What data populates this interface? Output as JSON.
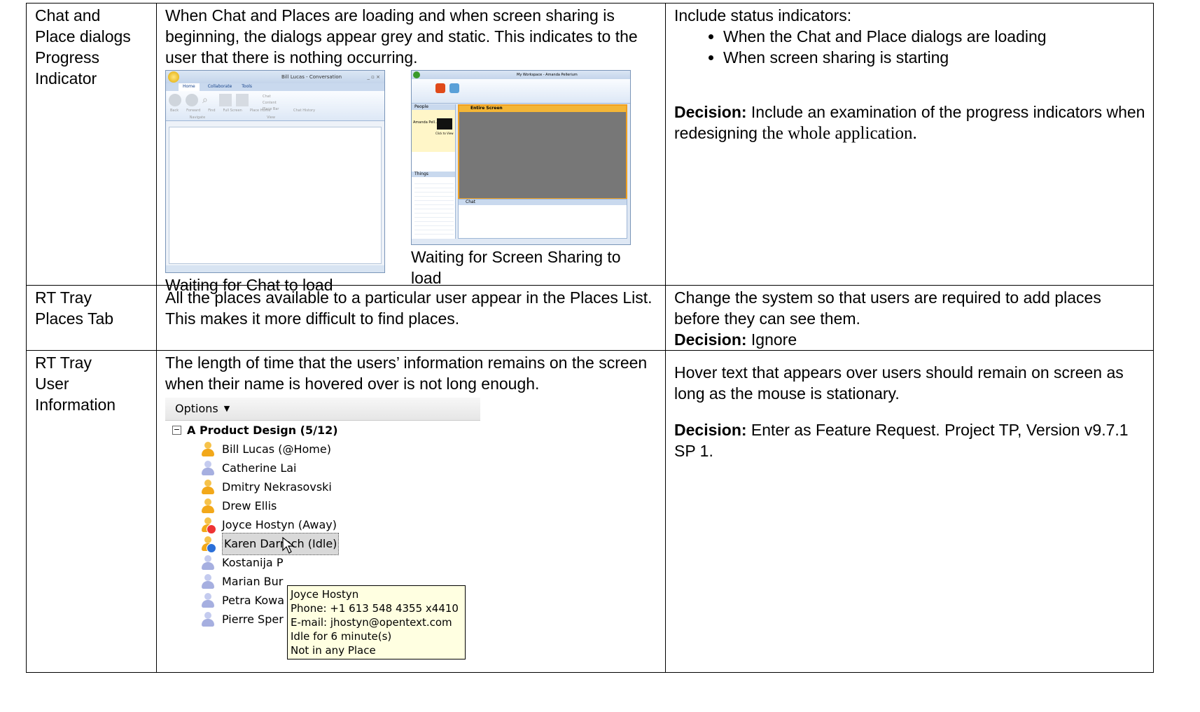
{
  "rows": [
    {
      "area": "Chat and Place dialogs Progress Indicator",
      "issue": "When Chat and Places are loading and when screen sharing is beginning, the dialogs appear grey and static. This indicates to the user that there is nothing occurring.",
      "rec_intro": "Include status indicators:",
      "rec_bullets": [
        "When the Chat and Place dialogs are loading",
        "When screen sharing is starting"
      ],
      "decision_label": "Decision:",
      "decision_a": "Include an examination of the progress indicators when redesigning",
      "decision_b": "the whole application.",
      "caption_left": "Waiting for Chat to load",
      "caption_right": "Waiting for Screen Sharing to load"
    },
    {
      "area_line1": "RT Tray",
      "area_line2": "Places Tab",
      "issue": "All the places available to a particular user appear in the Places List. This makes it more difficult to find places.",
      "rec": "Change the system so that users are required to add places before they can see them.",
      "decision_label": "Decision:",
      "decision": "Ignore"
    },
    {
      "area_line1": "RT Tray",
      "area_line2": "User Information",
      "issue": "The length of time that the users’ information remains on the screen when their name is hovered over is not long enough.",
      "rec": "Hover text that appears over users should remain on screen as long as the mouse is stationary.",
      "decision_label": "Decision:",
      "decision": "Enter as Feature Request. Project TP, Version v9.7.1 SP 1."
    }
  ],
  "chat_window": {
    "title": "Bill Lucas - Conversation",
    "tabs": [
      "Home",
      "Collaborate",
      "Tools"
    ],
    "buttons": [
      "Back",
      "Forward",
      "Find",
      "Full Screen",
      "Place Home",
      "Chat",
      "Content",
      "Place Bar",
      "Chat History"
    ],
    "groups": [
      "Navigate",
      "View"
    ]
  },
  "share_window": {
    "title": "My Workspace - Amanda Pellerium",
    "panel_title": "Entire Screen",
    "people": "People",
    "things": "Things",
    "chat": "Chat",
    "user": "Amanda Pell...",
    "click_to_view": "Click to View"
  },
  "contacts": {
    "options_label": "Options",
    "group": "A Product Design (5/12)",
    "items": [
      {
        "name": "Bill Lucas (@Home)",
        "status": "online"
      },
      {
        "name": "Catherine Lai",
        "status": "offline"
      },
      {
        "name": "Dmitry Nekrasovski",
        "status": "online"
      },
      {
        "name": "Drew Ellis",
        "status": "online"
      },
      {
        "name": "Joyce Hostyn (Away)",
        "status": "away"
      },
      {
        "name": "Karen Darroch (Idle)",
        "status": "idle"
      },
      {
        "name": "Kostanija P",
        "status": "offline"
      },
      {
        "name": "Marian Bur",
        "status": "offline"
      },
      {
        "name": "Petra Kowa",
        "status": "offline"
      },
      {
        "name": "Pierre Sper",
        "status": "offline"
      }
    ],
    "tooltip": [
      "Joyce Hostyn",
      "Phone: +1 613 548 4355 x4410",
      "E-mail: jhostyn@opentext.com",
      "Idle for 6 minute(s)",
      "Not in any Place"
    ]
  }
}
